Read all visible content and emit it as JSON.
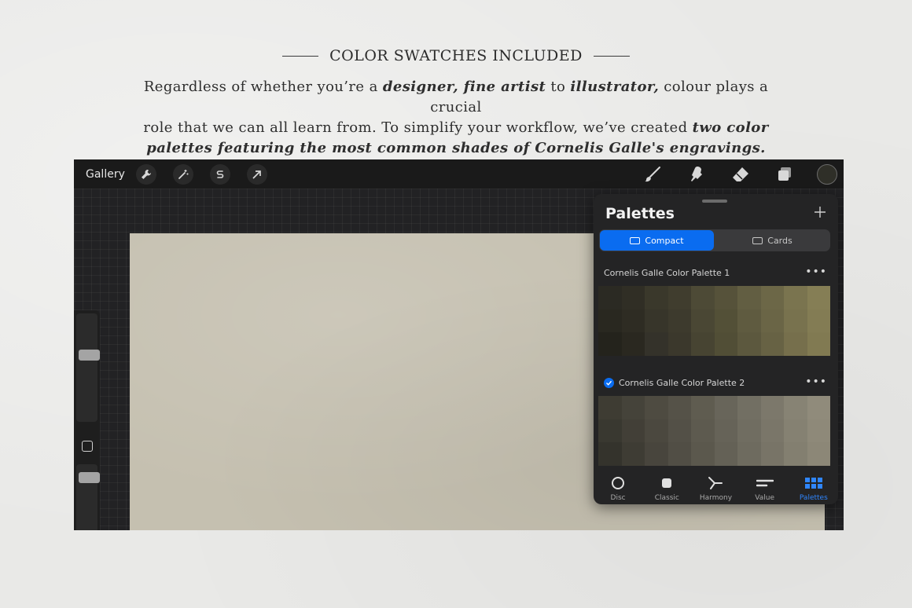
{
  "heading": "COLOR SWATCHES INCLUDED",
  "intro": {
    "line1_a": "Regardless of whether you’re a ",
    "line1_b": "designer, fine artist",
    "line1_c": " to ",
    "line1_d": "illustrator,",
    "line1_e": " colour plays a crucial",
    "line2_a": "role that we can all learn from. To simplify your workflow, we’ve created ",
    "line2_b": "two color",
    "line3": "palettes featuring the most common shades of Cornelis Galle's engravings."
  },
  "app": {
    "topbar": {
      "gallery_label": "Gallery",
      "left_icons": [
        "wrench-icon",
        "magic-wand-icon",
        "selection-s-icon",
        "transform-arrow-icon"
      ],
      "right_icons": [
        "brush-icon",
        "smudge-icon",
        "eraser-icon",
        "layers-icon"
      ],
      "current_color": "#2f2f28"
    },
    "panel": {
      "title": "Palettes",
      "segments": [
        {
          "label": "Compact",
          "active": true
        },
        {
          "label": "Cards",
          "active": false
        }
      ],
      "palettes": [
        {
          "name": "Cornelis Galle Color Palette 1",
          "checked": false,
          "more": "•••",
          "colors": [
            "#2b2a23",
            "#302e25",
            "#3a382b",
            "#403d2e",
            "#4d4a36",
            "#56523a",
            "#625e42",
            "#6c6747",
            "#7a744f",
            "#857e55",
            "#292820",
            "#2e2c23",
            "#37352a",
            "#3d3a2d",
            "#4a4734",
            "#535037",
            "#5f5b40",
            "#6a6546",
            "#78724e",
            "#837c54",
            "#24231c",
            "#2a2820",
            "#34322a",
            "#3b382c",
            "#474432",
            "#514e36",
            "#5c583e",
            "#676244",
            "#766f4c",
            "#817a52"
          ]
        },
        {
          "name": "Cornelis Galle Color Palette 2",
          "checked": true,
          "more": "•••",
          "colors": [
            "#3e3c33",
            "#45433a",
            "#4e4b41",
            "#555248",
            "#5f5c50",
            "#68655a",
            "#726f63",
            "#7c786b",
            "#878374",
            "#908b7b",
            "#393830",
            "#423f37",
            "#4b483f",
            "#535047",
            "#5d5a4f",
            "#666358",
            "#706d61",
            "#7a7669",
            "#858172",
            "#8e8979",
            "#34332c",
            "#3e3c34",
            "#48453d",
            "#514e45",
            "#5b584d",
            "#646156",
            "#6e6b5f",
            "#787467",
            "#837f70",
            "#8c8777"
          ]
        }
      ],
      "tabs": [
        {
          "label": "Disc",
          "icon": "disc-icon",
          "active": false
        },
        {
          "label": "Classic",
          "icon": "classic-square-icon",
          "active": false
        },
        {
          "label": "Harmony",
          "icon": "harmony-icon",
          "active": false
        },
        {
          "label": "Value",
          "icon": "value-sliders-icon",
          "active": false
        },
        {
          "label": "Palettes",
          "icon": "palettes-grid-icon",
          "active": true
        }
      ]
    }
  }
}
